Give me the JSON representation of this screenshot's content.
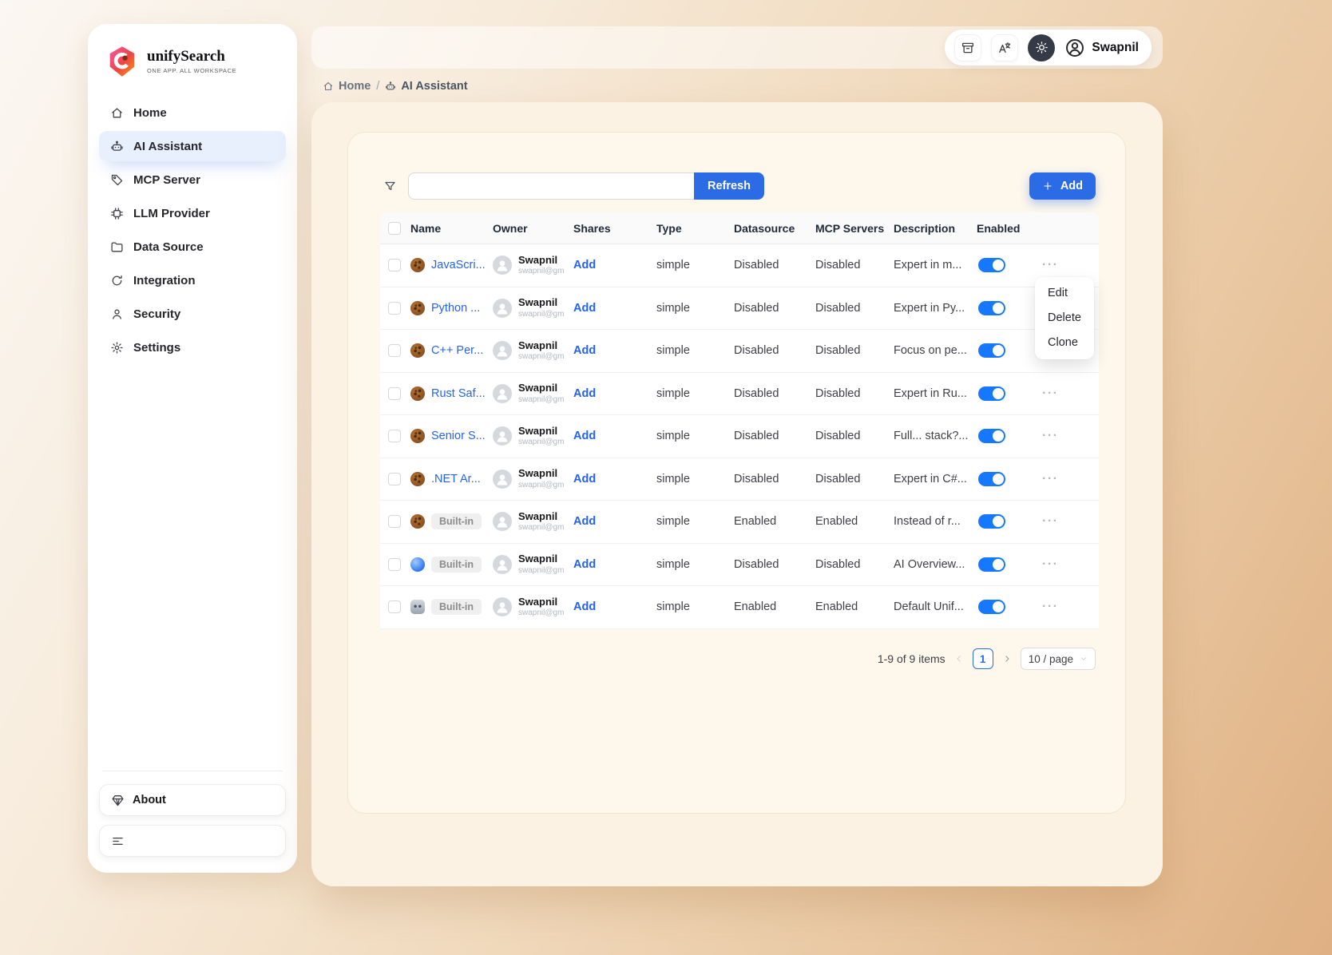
{
  "brand": {
    "name": "unifySearch",
    "tagline": "ONE APP. ALL WORKSPACE"
  },
  "topbar": {
    "user_name": "Swapnil"
  },
  "breadcrumb": {
    "home": "Home",
    "separator": "/",
    "current": "AI Assistant"
  },
  "sidebar": {
    "items": [
      {
        "label": "Home",
        "icon": "home",
        "active": false
      },
      {
        "label": "AI Assistant",
        "icon": "assistant",
        "active": true
      },
      {
        "label": "MCP Server",
        "icon": "server",
        "active": false
      },
      {
        "label": "LLM Provider",
        "icon": "provider",
        "active": false
      },
      {
        "label": "Data Source",
        "icon": "datasource",
        "active": false
      },
      {
        "label": "Integration",
        "icon": "integration",
        "active": false
      },
      {
        "label": "Security",
        "icon": "security",
        "active": false
      },
      {
        "label": "Settings",
        "icon": "settings",
        "active": false
      }
    ],
    "about_label": "About"
  },
  "toolbar": {
    "search_value": "",
    "search_placeholder": "",
    "refresh_label": "Refresh",
    "add_label": "Add"
  },
  "table": {
    "headers": [
      "Name",
      "Owner",
      "Shares",
      "Type",
      "Datasource",
      "MCP Servers",
      "Description",
      "Enabled"
    ],
    "rows": [
      {
        "icon": "cookie",
        "name": "JavaScri...",
        "badge": "",
        "owner": "Swapnil",
        "owner_email": "swapnil@gm",
        "shares": "Add",
        "type": "simple",
        "datasource": "Disabled",
        "mcp_servers": "Disabled",
        "description": "Expert in m...",
        "enabled": true
      },
      {
        "icon": "cookie",
        "name": "Python ...",
        "badge": "",
        "owner": "Swapnil",
        "owner_email": "swapnil@gm",
        "shares": "Add",
        "type": "simple",
        "datasource": "Disabled",
        "mcp_servers": "Disabled",
        "description": "Expert in Py...",
        "enabled": true
      },
      {
        "icon": "cookie",
        "name": "C++ Per...",
        "badge": "",
        "owner": "Swapnil",
        "owner_email": "swapnil@gm",
        "shares": "Add",
        "type": "simple",
        "datasource": "Disabled",
        "mcp_servers": "Disabled",
        "description": "Focus on pe...",
        "enabled": true
      },
      {
        "icon": "cookie",
        "name": "Rust Saf...",
        "badge": "",
        "owner": "Swapnil",
        "owner_email": "swapnil@gm",
        "shares": "Add",
        "type": "simple",
        "datasource": "Disabled",
        "mcp_servers": "Disabled",
        "description": "Expert in Ru...",
        "enabled": true
      },
      {
        "icon": "cookie",
        "name": "Senior S...",
        "badge": "",
        "owner": "Swapnil",
        "owner_email": "swapnil@gm",
        "shares": "Add",
        "type": "simple",
        "datasource": "Disabled",
        "mcp_servers": "Disabled",
        "description": "Full... stack?...",
        "enabled": true
      },
      {
        "icon": "cookie",
        "name": ".NET Ar...",
        "badge": "",
        "owner": "Swapnil",
        "owner_email": "swapnil@gm",
        "shares": "Add",
        "type": "simple",
        "datasource": "Disabled",
        "mcp_servers": "Disabled",
        "description": "Expert in C#...",
        "enabled": true
      },
      {
        "icon": "cookie",
        "name": "",
        "badge": "Built-in",
        "owner": "Swapnil",
        "owner_email": "swapnil@gm",
        "shares": "Add",
        "type": "simple",
        "datasource": "Enabled",
        "mcp_servers": "Enabled",
        "description": "Instead of r...",
        "enabled": true
      },
      {
        "icon": "globe",
        "name": "",
        "badge": "Built-in",
        "owner": "Swapnil",
        "owner_email": "swapnil@gm",
        "shares": "Add",
        "type": "simple",
        "datasource": "Disabled",
        "mcp_servers": "Disabled",
        "description": "AI Overview...",
        "enabled": true
      },
      {
        "icon": "robot",
        "name": "",
        "badge": "Built-in",
        "owner": "Swapnil",
        "owner_email": "swapnil@gm",
        "shares": "Add",
        "type": "simple",
        "datasource": "Enabled",
        "mcp_servers": "Enabled",
        "description": "Default Unif...",
        "enabled": true
      }
    ]
  },
  "context_menu": {
    "items": [
      "Edit",
      "Delete",
      "Clone"
    ]
  },
  "pagination": {
    "total_text": "1-9 of 9 items",
    "current_page": "1",
    "page_size": "10 / page"
  },
  "colors": {
    "accent": "#2b6ce6",
    "link": "#2563eb",
    "toggle_on": "#1677ff",
    "card_cream": "#fcf2e4"
  }
}
